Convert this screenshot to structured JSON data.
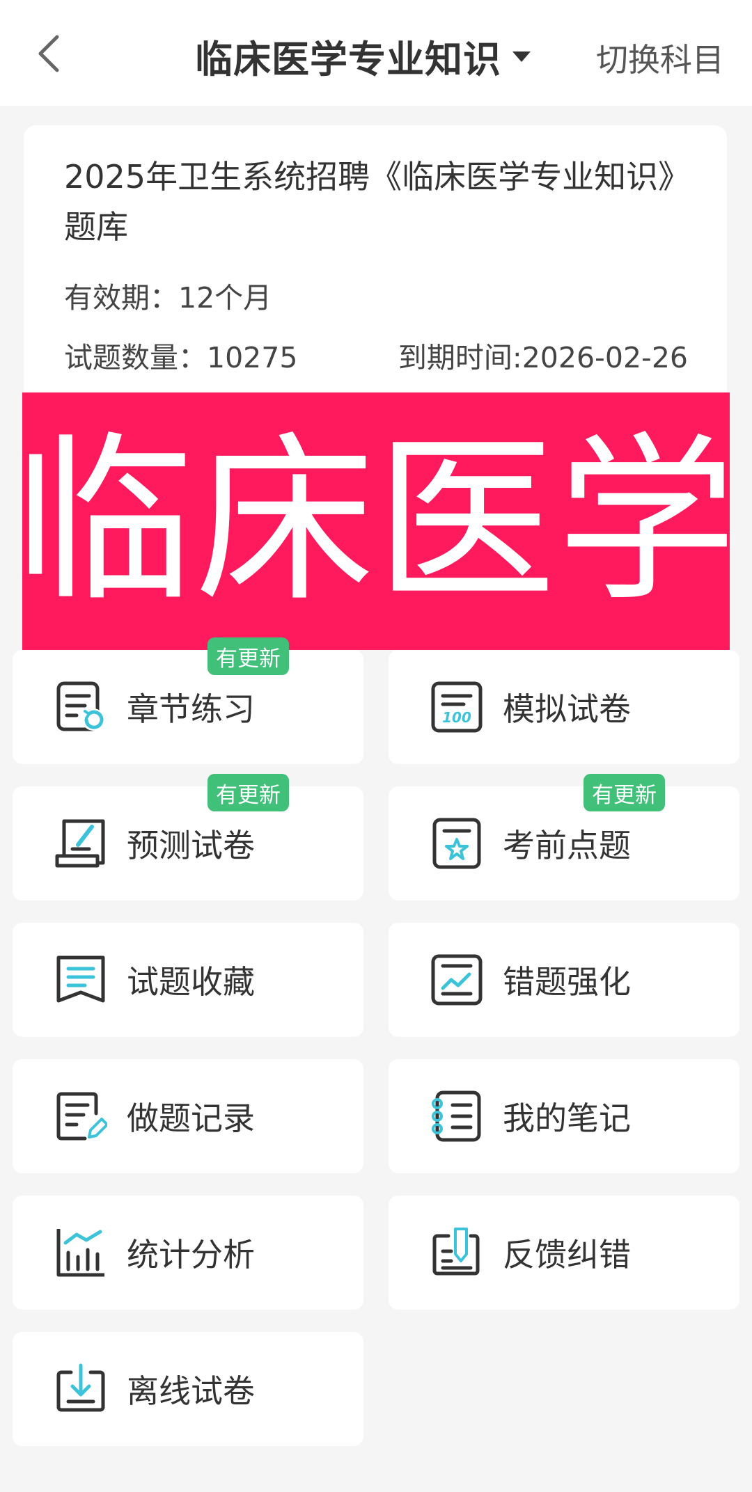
{
  "header": {
    "title": "临床医学专业知识",
    "switch_label": "切换科目"
  },
  "info": {
    "title": "2025年卫生系统招聘《临床医学专业知识》题库",
    "validity": "有效期：12个月",
    "count": "试题数量：10275",
    "expiry": "到期时间:2026-02-26"
  },
  "banner": {
    "text": "临床医学",
    "color": "#ff1a5d"
  },
  "colors": {
    "accent_cyan": "#3cc3d9",
    "badge_green": "#41c07a",
    "icon_dark": "#333333"
  },
  "tiles": [
    {
      "label": "章节练习",
      "icon": "chapter-practice-icon",
      "badge": "有更新"
    },
    {
      "label": "模拟试卷",
      "icon": "mock-exam-icon",
      "badge": ""
    },
    {
      "label": "预测试卷",
      "icon": "prediction-exam-icon",
      "badge": "有更新"
    },
    {
      "label": "考前点题",
      "icon": "key-points-icon",
      "badge": "有更新"
    },
    {
      "label": "试题收藏",
      "icon": "bookmark-icon",
      "badge": ""
    },
    {
      "label": "错题强化",
      "icon": "wrong-questions-icon",
      "badge": ""
    },
    {
      "label": "做题记录",
      "icon": "record-icon",
      "badge": ""
    },
    {
      "label": "我的笔记",
      "icon": "notes-icon",
      "badge": ""
    },
    {
      "label": "统计分析",
      "icon": "statistics-icon",
      "badge": ""
    },
    {
      "label": "反馈纠错",
      "icon": "feedback-icon",
      "badge": ""
    },
    {
      "label": "离线试卷",
      "icon": "offline-download-icon",
      "badge": ""
    }
  ]
}
